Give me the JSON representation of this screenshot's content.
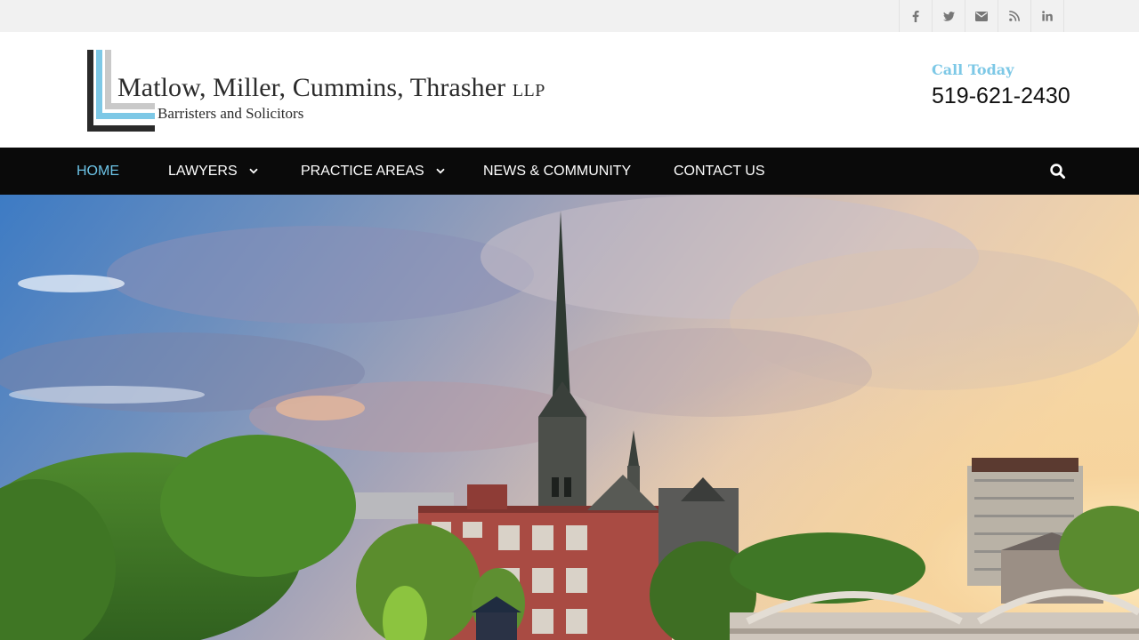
{
  "social": [
    {
      "name": "facebook-icon",
      "glyph": "f"
    },
    {
      "name": "twitter-icon",
      "glyph": "twitter"
    },
    {
      "name": "email-icon",
      "glyph": "envelope"
    },
    {
      "name": "rss-icon",
      "glyph": "rss"
    },
    {
      "name": "linkedin-icon",
      "glyph": "in"
    }
  ],
  "logo": {
    "name": "Matlow, Miller, Cummins, Thrasher",
    "suffix": "LLP",
    "tagline": "Barristers and Solicitors"
  },
  "contact": {
    "label": "Call Today",
    "phone": "519-621-2430"
  },
  "nav": {
    "items": [
      {
        "label": "HOME",
        "active": true,
        "dropdown": false
      },
      {
        "label": "LAWYERS",
        "active": false,
        "dropdown": true
      },
      {
        "label": "PRACTICE AREAS",
        "active": false,
        "dropdown": true
      },
      {
        "label": "NEWS & COMMUNITY",
        "active": false,
        "dropdown": false
      },
      {
        "label": "CONTACT US",
        "active": false,
        "dropdown": false
      }
    ],
    "search_icon": "search-icon"
  },
  "colors": {
    "accent": "#6cc3e6",
    "nav_bg": "#0a0a0a",
    "topbar_bg": "#f1f1f1",
    "logo_blue": "#7dc8e6"
  },
  "hero": {
    "image": "city-skyline-church-spire-photo"
  }
}
